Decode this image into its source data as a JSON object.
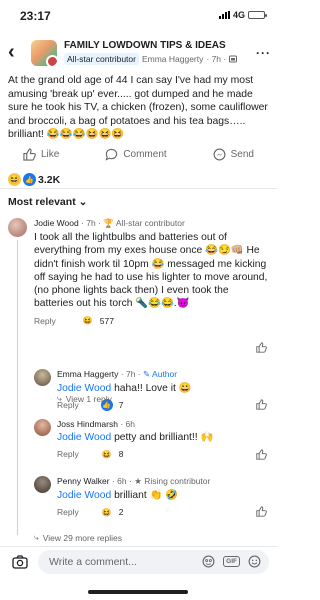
{
  "status": {
    "time": "23:17",
    "network": "4G"
  },
  "header": {
    "group_name": "FAMILY LOWDOWN TIPS & IDEAS",
    "badge": "All-star contributor",
    "poster": "Emma Haggerty",
    "time": "· 7h ·",
    "privacy_icon": "group-privacy-icon"
  },
  "post": {
    "text": "At the grand old age of 44 I can say I've had my most amusing 'break up' ever..... got dumped and he made sure he took his TV, a chicken (frozen), some cauliflower and broccoli, a bag of potatoes and his tea bags….. brilliant! 😂😂😂😆😆😆"
  },
  "actions": {
    "like": "Like",
    "comment": "Comment",
    "send": "Send"
  },
  "reactions": {
    "count": "3.2K"
  },
  "sort": {
    "label": "Most relevant",
    "chevron": "⌄"
  },
  "comments": [
    {
      "name": "Jodie Wood",
      "meta": "· 7h ·",
      "badge": "All-star contributor",
      "text": "I took all the lightbulbs and batteries out of everything from my exes house once 😂😏👊🏼 He didn't finish work til 10pm 😂 messaged me kicking off saying he had to use his lighter to move around, (no phone lights back then) I even took the batteries out his torch 🔦😂😂.😈",
      "reply": "Reply",
      "count": "577"
    },
    {
      "name": "Emma Haggerty",
      "meta": "· 7h ·",
      "author": "Author",
      "mention": "Jodie Wood",
      "text": "haha!! Love it 😀",
      "reply": "Reply",
      "count": "7"
    },
    {
      "name": "Joss Hindmarsh",
      "meta": "· 6h",
      "mention": "Jodie Wood",
      "text": "petty and brilliant!! 🙌",
      "reply": "Reply",
      "count": "8"
    },
    {
      "name": "Penny Walker",
      "meta": "· 6h ·",
      "badge": "Rising contributor",
      "mention": "Jodie Wood",
      "text": "brilliant 👏 🤣",
      "reply": "Reply",
      "count": "2"
    }
  ],
  "view_reply": "View 1 reply",
  "view_more": "View 29 more replies",
  "composer": {
    "placeholder": "Write a comment...",
    "gif": "GIF"
  },
  "colors": {
    "accent": "#1877f2",
    "muted": "#65676b",
    "badge_bg": "#e7f3ff"
  }
}
